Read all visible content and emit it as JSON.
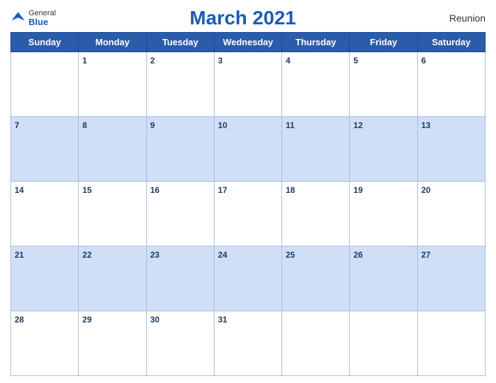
{
  "header": {
    "title": "March 2021",
    "region": "Reunion",
    "logo": {
      "general": "General",
      "blue": "Blue"
    }
  },
  "weekdays": [
    "Sunday",
    "Monday",
    "Tuesday",
    "Wednesday",
    "Thursday",
    "Friday",
    "Saturday"
  ],
  "weeks": [
    [
      {
        "day": "",
        "bg": "white"
      },
      {
        "day": "1",
        "bg": "white"
      },
      {
        "day": "2",
        "bg": "white"
      },
      {
        "day": "3",
        "bg": "white"
      },
      {
        "day": "4",
        "bg": "white"
      },
      {
        "day": "5",
        "bg": "white"
      },
      {
        "day": "6",
        "bg": "white"
      }
    ],
    [
      {
        "day": "7",
        "bg": "blue"
      },
      {
        "day": "8",
        "bg": "blue"
      },
      {
        "day": "9",
        "bg": "blue"
      },
      {
        "day": "10",
        "bg": "blue"
      },
      {
        "day": "11",
        "bg": "blue"
      },
      {
        "day": "12",
        "bg": "blue"
      },
      {
        "day": "13",
        "bg": "blue"
      }
    ],
    [
      {
        "day": "14",
        "bg": "white"
      },
      {
        "day": "15",
        "bg": "white"
      },
      {
        "day": "16",
        "bg": "white"
      },
      {
        "day": "17",
        "bg": "white"
      },
      {
        "day": "18",
        "bg": "white"
      },
      {
        "day": "19",
        "bg": "white"
      },
      {
        "day": "20",
        "bg": "white"
      }
    ],
    [
      {
        "day": "21",
        "bg": "blue"
      },
      {
        "day": "22",
        "bg": "blue"
      },
      {
        "day": "23",
        "bg": "blue"
      },
      {
        "day": "24",
        "bg": "blue"
      },
      {
        "day": "25",
        "bg": "blue"
      },
      {
        "day": "26",
        "bg": "blue"
      },
      {
        "day": "27",
        "bg": "blue"
      }
    ],
    [
      {
        "day": "28",
        "bg": "white"
      },
      {
        "day": "29",
        "bg": "white"
      },
      {
        "day": "30",
        "bg": "white"
      },
      {
        "day": "31",
        "bg": "white"
      },
      {
        "day": "",
        "bg": "white"
      },
      {
        "day": "",
        "bg": "white"
      },
      {
        "day": "",
        "bg": "white"
      }
    ]
  ]
}
